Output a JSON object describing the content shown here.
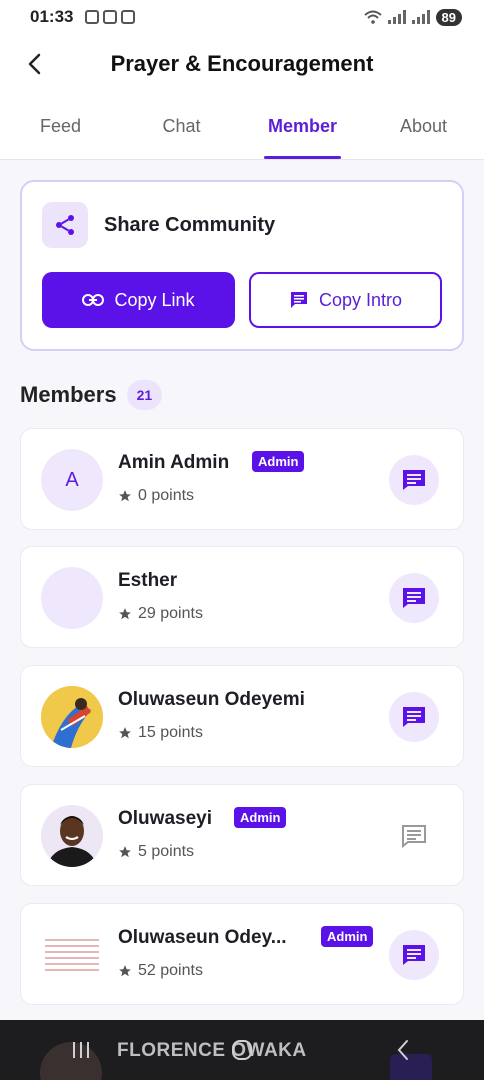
{
  "status_bar": {
    "time": "01:33",
    "battery": "89"
  },
  "app_bar": {
    "title": "Prayer & Encouragement",
    "back_icon": "chevron-left-icon"
  },
  "tabs": [
    {
      "label": "Feed",
      "active": false
    },
    {
      "label": "Chat",
      "active": false
    },
    {
      "label": "Member",
      "active": true
    },
    {
      "label": "About",
      "active": false
    }
  ],
  "share": {
    "title": "Share Community",
    "icon": "share-icon",
    "copy_link_label": "Copy Link",
    "copy_intro_label": "Copy Intro"
  },
  "members_section": {
    "title": "Members",
    "count": "21"
  },
  "members": [
    {
      "name": "Amin Admin",
      "admin_label": "Admin",
      "points": "0 points",
      "avatar": "A"
    },
    {
      "name": "Esther",
      "admin_label": "",
      "points": "29 points",
      "avatar": ""
    },
    {
      "name": "Oluwaseun Odeyemi",
      "admin_label": "",
      "points": "15 points",
      "avatar": ""
    },
    {
      "name": "Oluwaseyi",
      "admin_label": "Admin",
      "points": "5 points",
      "avatar": ""
    },
    {
      "name": "Oluwaseun Odey...",
      "admin_label": "Admin",
      "points": "52 points",
      "avatar": ""
    }
  ],
  "peek_member": {
    "name": "FLORENCE OWAKA"
  },
  "colors": {
    "accent": "#5b12e8",
    "accent_light": "#ece4fb",
    "badge_text": "#ffffff"
  }
}
